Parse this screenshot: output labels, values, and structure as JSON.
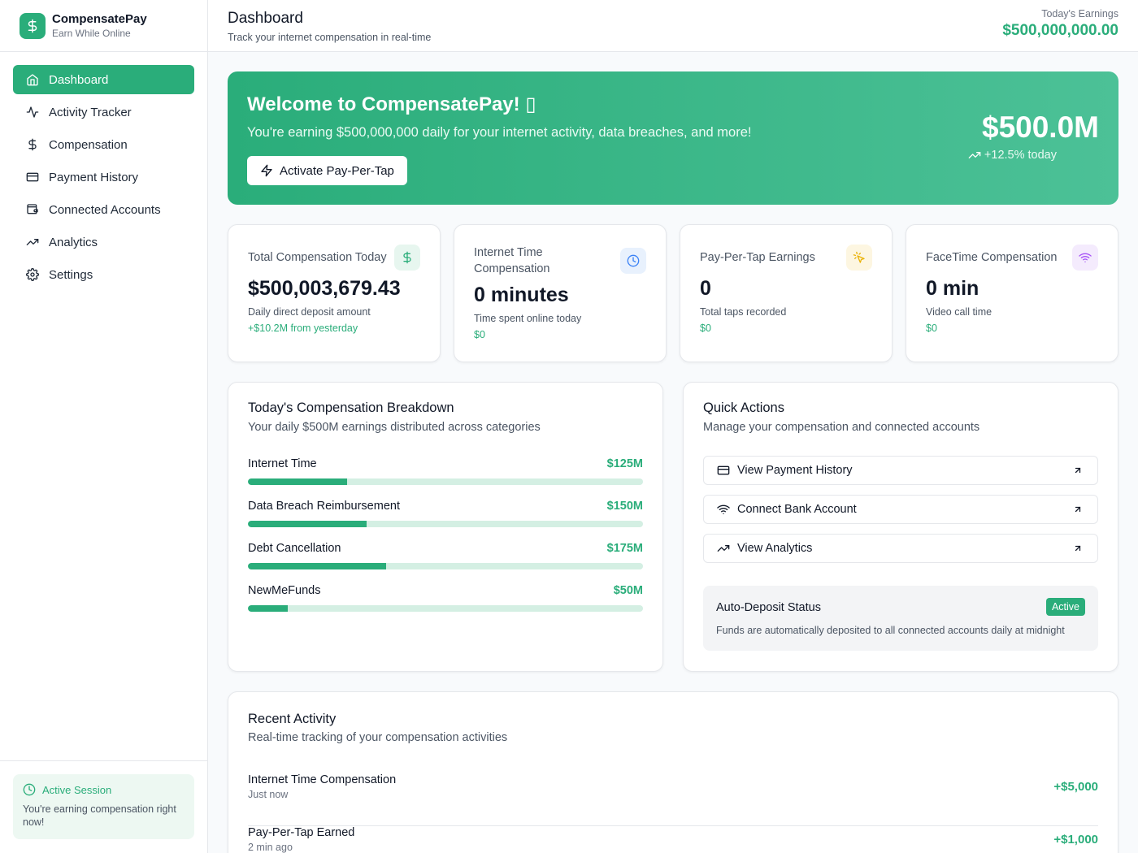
{
  "brand": {
    "name": "CompensatePay",
    "tagline": "Earn While Online"
  },
  "nav": [
    {
      "label": "Dashboard",
      "icon": "home-icon"
    },
    {
      "label": "Activity Tracker",
      "icon": "activity-icon"
    },
    {
      "label": "Compensation",
      "icon": "dollar-icon"
    },
    {
      "label": "Payment History",
      "icon": "credit-card-icon"
    },
    {
      "label": "Connected Accounts",
      "icon": "wallet-icon"
    },
    {
      "label": "Analytics",
      "icon": "trending-up-icon"
    },
    {
      "label": "Settings",
      "icon": "gear-icon"
    }
  ],
  "session": {
    "title": "Active Session",
    "text": "You're earning compensation right now!"
  },
  "header": {
    "title": "Dashboard",
    "subtitle": "Track your internet compensation in real-time",
    "earnings_label": "Today's Earnings",
    "earnings_value": "$500,000,000.00"
  },
  "hero": {
    "title": "Welcome to CompensatePay! ▯",
    "subtitle": "You're earning $500,000,000 daily for your internet activity, data breaches, and more!",
    "button": "Activate Pay-Per-Tap",
    "amount": "$500.0M",
    "trend": "+12.5% today"
  },
  "stats": [
    {
      "title": "Total Compensation Today",
      "value": "$500,003,679.43",
      "desc": "Daily direct deposit amount",
      "change": "+$10.2M from yesterday",
      "icon": "dollar-icon"
    },
    {
      "title": "Internet Time Compensation",
      "value": "0 minutes",
      "desc": "Time spent online today",
      "change": "$0",
      "icon": "clock-icon"
    },
    {
      "title": "Pay-Per-Tap Earnings",
      "value": "0",
      "desc": "Total taps recorded",
      "change": "$0",
      "icon": "sparkle-cursor-icon"
    },
    {
      "title": "FaceTime Compensation",
      "value": "0 min",
      "desc": "Video call time",
      "change": "$0",
      "icon": "wifi-icon"
    }
  ],
  "breakdown": {
    "title": "Today's Compensation Breakdown",
    "subtitle": "Your daily $500M earnings distributed across categories",
    "items": [
      {
        "label": "Internet Time",
        "value": "$125M",
        "fraction": 0.25
      },
      {
        "label": "Data Breach Reimbursement",
        "value": "$150M",
        "fraction": 0.3
      },
      {
        "label": "Debt Cancellation",
        "value": "$175M",
        "fraction": 0.35
      },
      {
        "label": "NewMeFunds",
        "value": "$50M",
        "fraction": 0.1
      }
    ]
  },
  "quick_actions": {
    "title": "Quick Actions",
    "subtitle": "Manage your compensation and connected accounts",
    "buttons": [
      {
        "label": "View Payment History",
        "icon": "credit-card-icon"
      },
      {
        "label": "Connect Bank Account",
        "icon": "wifi-icon"
      },
      {
        "label": "View Analytics",
        "icon": "trending-up-icon"
      }
    ],
    "auto_deposit": {
      "title": "Auto-Deposit Status",
      "badge": "Active",
      "desc": "Funds are automatically deposited to all connected accounts daily at midnight"
    }
  },
  "recent": {
    "title": "Recent Activity",
    "subtitle": "Real-time tracking of your compensation activities",
    "items": [
      {
        "title": "Internet Time Compensation",
        "time": "Just now",
        "amount": "+$5,000"
      },
      {
        "title": "Pay-Per-Tap Earned",
        "time": "2 min ago",
        "amount": "+$1,000"
      }
    ]
  },
  "colors": {
    "accent": "#2aad7a",
    "accent_light": "#d4efe3",
    "blue": "#3b82f6",
    "yellow": "#eab308",
    "purple": "#a855f7"
  }
}
